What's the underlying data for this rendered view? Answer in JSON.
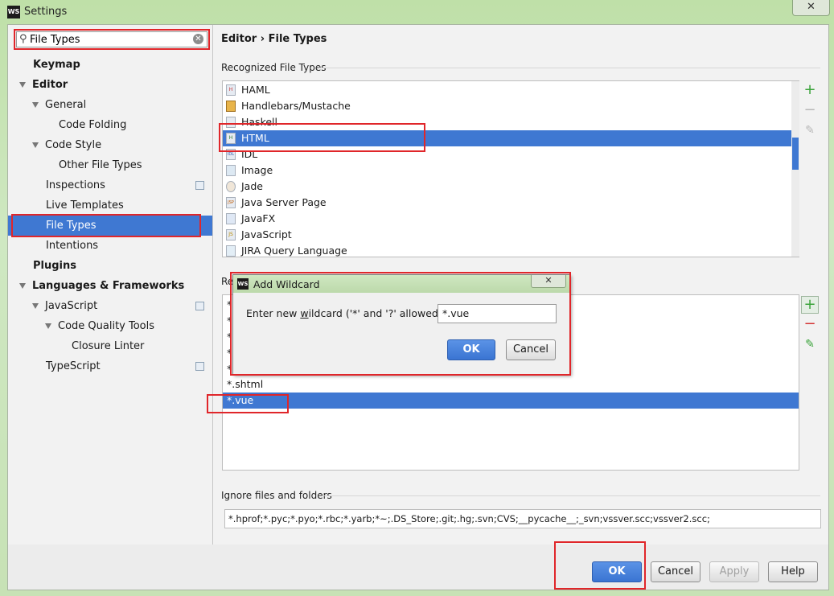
{
  "window": {
    "title": "Settings",
    "icon_text": "WS",
    "close_glyph": "✕"
  },
  "search": {
    "value": "File Types",
    "clear_glyph": "⊗",
    "icon": "search-icon"
  },
  "sidebar": {
    "items": [
      {
        "label": "Keymap"
      },
      {
        "label": "Editor"
      },
      {
        "label": "General"
      },
      {
        "label": "Code Folding"
      },
      {
        "label": "Code Style"
      },
      {
        "label": "Other File Types"
      },
      {
        "label": "Inspections"
      },
      {
        "label": "Live Templates"
      },
      {
        "label": "File Types"
      },
      {
        "label": "Intentions"
      },
      {
        "label": "Plugins"
      },
      {
        "label": "Languages & Frameworks"
      },
      {
        "label": "JavaScript"
      },
      {
        "label": "Code Quality Tools"
      },
      {
        "label": "Closure Linter"
      },
      {
        "label": "TypeScript"
      }
    ]
  },
  "main": {
    "breadcrumb": {
      "parent": "Editor",
      "separator": "›",
      "current": "File Types"
    },
    "recognized": {
      "label": "Recognized File Types",
      "items": [
        "HAML",
        "Handlebars/Mustache",
        "Haskell",
        "HTML",
        "IDL",
        "Image",
        "Jade",
        "Java Server Page",
        "JavaFX",
        "JavaScript",
        "JIRA Query Language"
      ],
      "icon_text": [
        "H",
        "",
        "",
        "H",
        "IDL",
        "",
        "",
        "JSP",
        "",
        "JS",
        ""
      ],
      "selected": "HTML"
    },
    "patterns": {
      "label_visible": "Re",
      "partial_rows": [
        "*",
        "*",
        "*",
        "*",
        "*"
      ],
      "items": [
        "*.shtml",
        "*.vue"
      ],
      "selected": "*.vue"
    },
    "ignore": {
      "label": "Ignore files and folders",
      "value": "*.hprof;*.pyc;*.pyo;*.rbc;*.yarb;*~;.DS_Store;.git;.hg;.svn;CVS;__pycache__;_svn;vssver.scc;vssver2.scc;"
    },
    "tools": {
      "add": "+",
      "remove": "−",
      "edit": "✎"
    }
  },
  "dialog": {
    "title": "Add Wildcard",
    "icon_text": "WS",
    "close_glyph": "✕",
    "prompt_before": "Enter new ",
    "prompt_underlined": "w",
    "prompt_after": "ildcard ('*' and '?' allowed):",
    "value": "*.vue",
    "ok_label": "OK",
    "cancel_label": "Cancel"
  },
  "footer": {
    "ok_label": "OK",
    "cancel_label": "Cancel",
    "apply_label": "Apply",
    "help_label": "Help"
  },
  "colors": {
    "selection": "#3f78d2",
    "highlight": "#e0262a",
    "add": "#3aa33a",
    "remove": "#d33333"
  }
}
